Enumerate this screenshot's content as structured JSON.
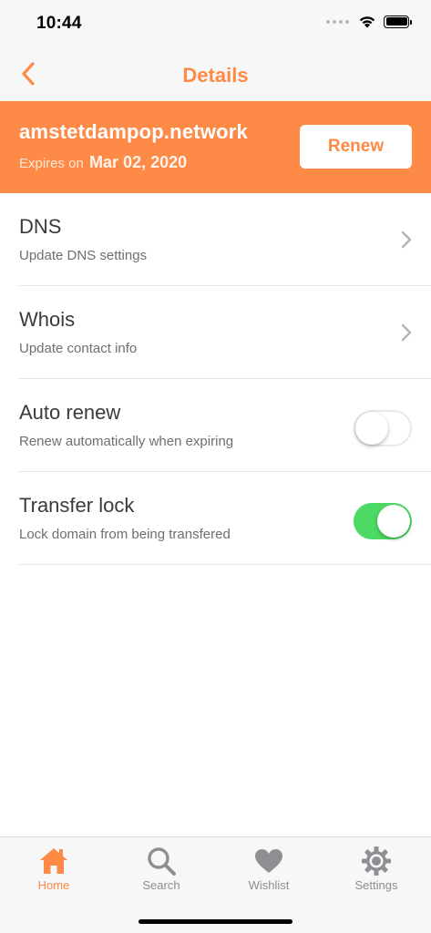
{
  "status_bar": {
    "time": "10:44"
  },
  "nav": {
    "title": "Details",
    "back_icon": "chevron-left-icon"
  },
  "colors": {
    "accent": "#fd8a45",
    "banner": "#fe8a47",
    "toggle_on": "#4cd964",
    "tab_inactive": "#8e8e93"
  },
  "banner": {
    "domain": "amstetdampop.network",
    "expires_label": "Expires on",
    "expires_date": "Mar 02, 2020",
    "renew_label": "Renew"
  },
  "settings": [
    {
      "title": "DNS",
      "subtitle": "Update DNS settings",
      "control": "chevron"
    },
    {
      "title": "Whois",
      "subtitle": "Update contact info",
      "control": "chevron"
    },
    {
      "title": "Auto renew",
      "subtitle": "Renew automatically when expiring",
      "control": "toggle",
      "on": false
    },
    {
      "title": "Transfer lock",
      "subtitle": "Lock domain from being transfered",
      "control": "toggle",
      "on": true
    }
  ],
  "tabs": [
    {
      "label": "Home",
      "icon": "home-icon",
      "active": true
    },
    {
      "label": "Search",
      "icon": "search-icon",
      "active": false
    },
    {
      "label": "Wishlist",
      "icon": "heart-icon",
      "active": false
    },
    {
      "label": "Settings",
      "icon": "gear-icon",
      "active": false
    }
  ]
}
